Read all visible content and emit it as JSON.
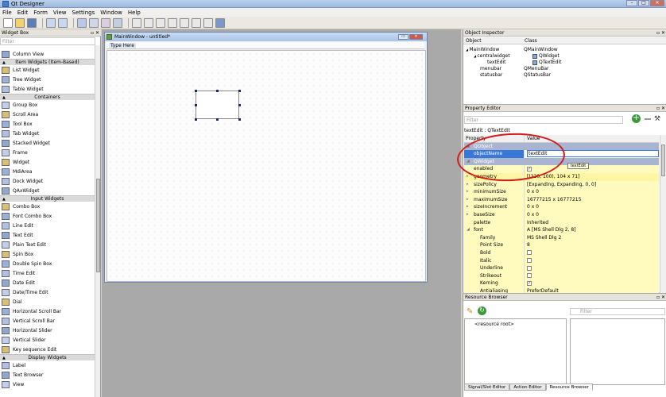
{
  "window": {
    "title": "Qt Designer"
  },
  "menubar": [
    "File",
    "Edit",
    "Form",
    "View",
    "Settings",
    "Window",
    "Help"
  ],
  "widget_box": {
    "title": "Widget Box",
    "filter_placeholder": "Filter",
    "items": [
      {
        "type": "item",
        "label": "Column View"
      },
      {
        "type": "cat",
        "label": "Item Widgets (Item-Based)"
      },
      {
        "type": "item",
        "label": "List Widget"
      },
      {
        "type": "item",
        "label": "Tree Widget"
      },
      {
        "type": "item",
        "label": "Table Widget"
      },
      {
        "type": "cat",
        "label": "Containers"
      },
      {
        "type": "item",
        "label": "Group Box"
      },
      {
        "type": "item",
        "label": "Scroll Area"
      },
      {
        "type": "item",
        "label": "Tool Box"
      },
      {
        "type": "item",
        "label": "Tab Widget"
      },
      {
        "type": "item",
        "label": "Stacked Widget"
      },
      {
        "type": "item",
        "label": "Frame"
      },
      {
        "type": "item",
        "label": "Widget"
      },
      {
        "type": "item",
        "label": "MdiArea"
      },
      {
        "type": "item",
        "label": "Dock Widget"
      },
      {
        "type": "item",
        "label": "QAxWidget"
      },
      {
        "type": "cat",
        "label": "Input Widgets"
      },
      {
        "type": "item",
        "label": "Combo Box"
      },
      {
        "type": "item",
        "label": "Font Combo Box"
      },
      {
        "type": "item",
        "label": "Line Edit"
      },
      {
        "type": "item",
        "label": "Text Edit"
      },
      {
        "type": "item",
        "label": "Plain Text Edit"
      },
      {
        "type": "item",
        "label": "Spin Box"
      },
      {
        "type": "item",
        "label": "Double Spin Box"
      },
      {
        "type": "item",
        "label": "Time Edit"
      },
      {
        "type": "item",
        "label": "Date Edit"
      },
      {
        "type": "item",
        "label": "Date/Time Edit"
      },
      {
        "type": "item",
        "label": "Dial"
      },
      {
        "type": "item",
        "label": "Horizontal Scroll Bar"
      },
      {
        "type": "item",
        "label": "Vertical Scroll Bar"
      },
      {
        "type": "item",
        "label": "Horizontal Slider"
      },
      {
        "type": "item",
        "label": "Vertical Slider"
      },
      {
        "type": "item",
        "label": "Key sequence Edit"
      },
      {
        "type": "cat",
        "label": "Display Widgets"
      },
      {
        "type": "item",
        "label": "Label"
      },
      {
        "type": "item",
        "label": "Text Browser"
      },
      {
        "type": "item",
        "label": "View"
      }
    ]
  },
  "form": {
    "title": "MainWindow - untitled*",
    "menu_placeholder": "Type Here"
  },
  "object_inspector": {
    "title": "Object Inspector",
    "col_object": "Object",
    "col_class": "Class",
    "rows": [
      {
        "object": "MainWindow",
        "class": "QMainWindow"
      },
      {
        "object": "centralwidget",
        "class": "QWidget"
      },
      {
        "object": "textEdit",
        "class": "QTextEdit"
      },
      {
        "object": "menubar",
        "class": "QMenuBar"
      },
      {
        "object": "statusbar",
        "class": "QStatusBar"
      }
    ]
  },
  "property_editor": {
    "title": "Property Editor",
    "filter_placeholder": "Filter",
    "path": "textEdit : QTextEdit",
    "col_property": "Property",
    "col_value": "Value",
    "tooltip": "textEdit",
    "rows": [
      {
        "name": "QObject",
        "value": "",
        "kind": "grp"
      },
      {
        "name": "objectName",
        "value": "textEdit",
        "kind": "edit"
      },
      {
        "name": "QWidget",
        "value": "",
        "kind": "grp"
      },
      {
        "name": "enabled",
        "value": "",
        "kind": "check",
        "checked": true
      },
      {
        "name": "geometry",
        "value": "[(220, 100), 104 x 71]",
        "kind": "yel2"
      },
      {
        "name": "sizePolicy",
        "value": "[Expanding, Expanding, 0, 0]",
        "kind": "yel"
      },
      {
        "name": "minimumSize",
        "value": "0 x 0",
        "kind": "yel"
      },
      {
        "name": "maximumSize",
        "value": "16777215 x 16777215",
        "kind": "yel"
      },
      {
        "name": "sizeIncrement",
        "value": "0 x 0",
        "kind": "yel"
      },
      {
        "name": "baseSize",
        "value": "0 x 0",
        "kind": "yel"
      },
      {
        "name": "palette",
        "value": "Inherited",
        "kind": "yel"
      },
      {
        "name": "font",
        "value": "A  [MS Shell Dlg 2, 8]",
        "kind": "yel"
      },
      {
        "name": "Family",
        "value": "MS Shell Dlg 2",
        "kind": "yel"
      },
      {
        "name": "Point Size",
        "value": "8",
        "kind": "yel"
      },
      {
        "name": "Bold",
        "value": "",
        "kind": "check",
        "checked": false
      },
      {
        "name": "Italic",
        "value": "",
        "kind": "check",
        "checked": false
      },
      {
        "name": "Underline",
        "value": "",
        "kind": "check",
        "checked": false
      },
      {
        "name": "Strikeout",
        "value": "",
        "kind": "check",
        "checked": false
      },
      {
        "name": "Kerning",
        "value": "",
        "kind": "check",
        "checked": true
      },
      {
        "name": "Antialiasing",
        "value": "PreferDefault",
        "kind": "yel"
      }
    ]
  },
  "resource_browser": {
    "title": "Resource Browser",
    "filter_placeholder": "Filter",
    "root": "<resource root>",
    "tabs": [
      "Signal/Slot Editor",
      "Action Editor",
      "Resource Browser"
    ]
  }
}
